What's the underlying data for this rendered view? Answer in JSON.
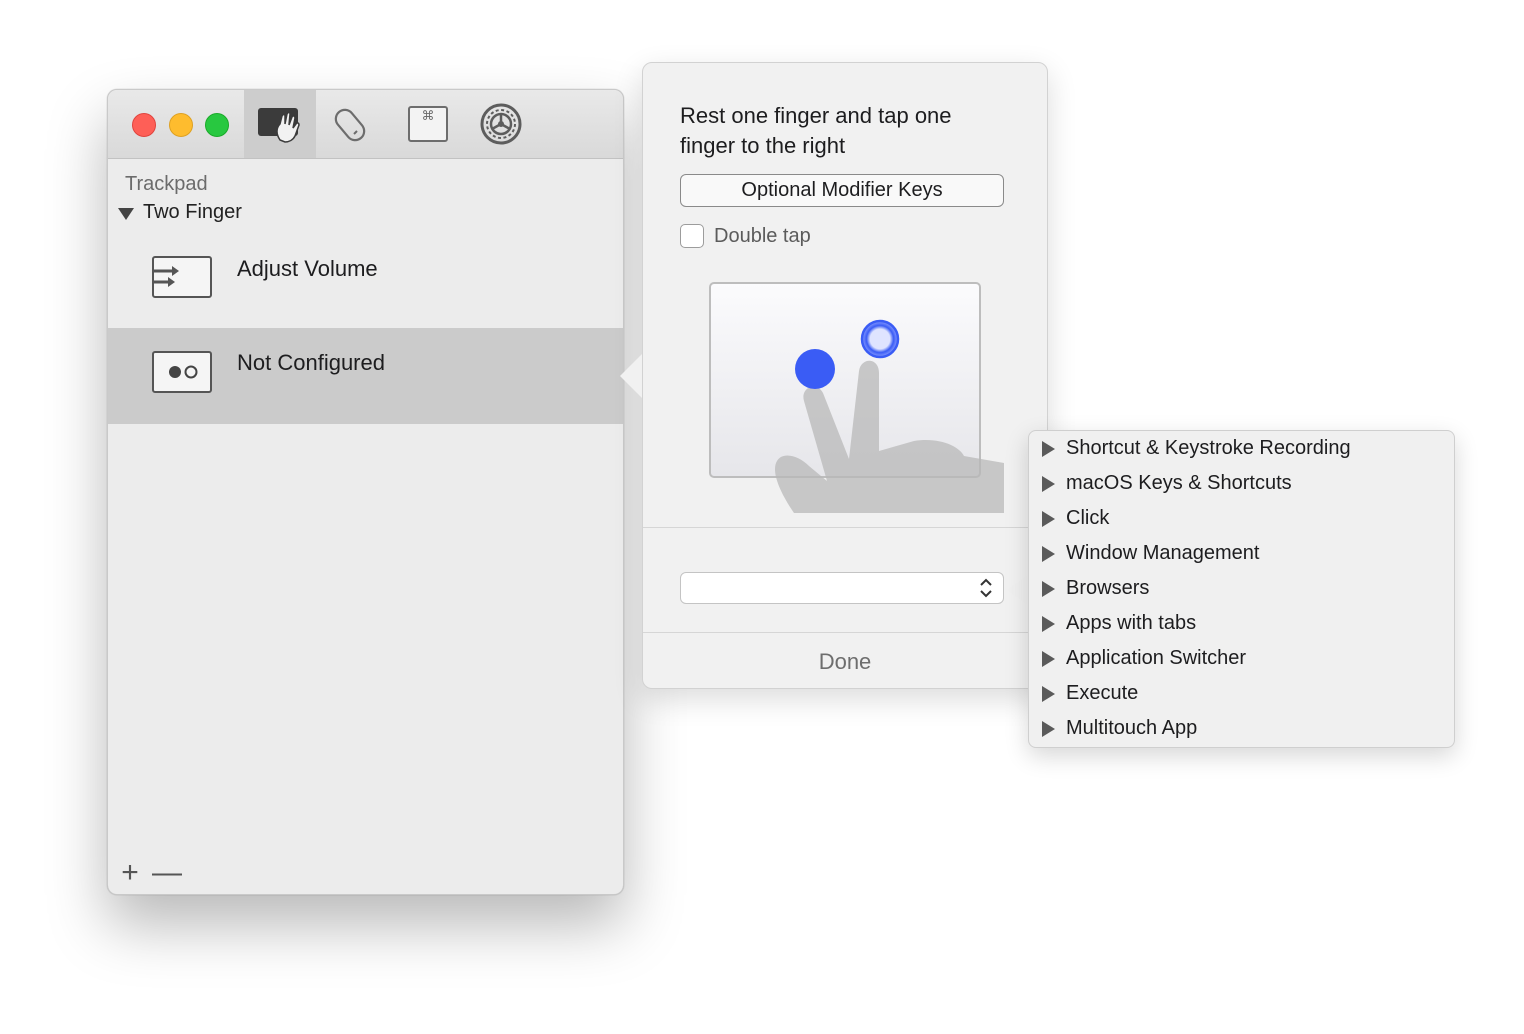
{
  "window": {
    "toolbar": {
      "items": [
        {
          "name": "trackpad-icon",
          "selected": true
        },
        {
          "name": "magic-mouse-icon",
          "selected": false
        },
        {
          "name": "keyboard-icon",
          "selected": false
        },
        {
          "name": "settings-icon",
          "selected": false
        }
      ]
    },
    "sidebar": {
      "header": "Trackpad",
      "group": "Two Finger",
      "gestures": [
        {
          "label": "Adjust Volume",
          "icon": "gesture-swipe-icon",
          "selected": false
        },
        {
          "label": "Not Configured",
          "icon": "gesture-tap-icon",
          "selected": true
        }
      ],
      "add_label": "+",
      "remove_label": "—"
    }
  },
  "popover": {
    "description": "Rest one finger and tap one finger to the right",
    "modifier_button": "Optional Modifier Keys",
    "double_tap_label": "Double tap",
    "double_tap_checked": false,
    "action_select_value": "",
    "done_label": "Done"
  },
  "menu": {
    "items": [
      "Shortcut & Keystroke Recording",
      "macOS Keys & Shortcuts",
      "Click",
      "Window Management",
      "Browsers",
      "Apps with tabs",
      "Application Switcher",
      "Execute",
      "Multitouch App"
    ]
  },
  "colors": {
    "accent": "#3a5cf5",
    "selected_row": "#cbcbcb",
    "traffic_red": "#fe5f57",
    "traffic_yellow": "#febc2e",
    "traffic_green": "#28c840"
  }
}
